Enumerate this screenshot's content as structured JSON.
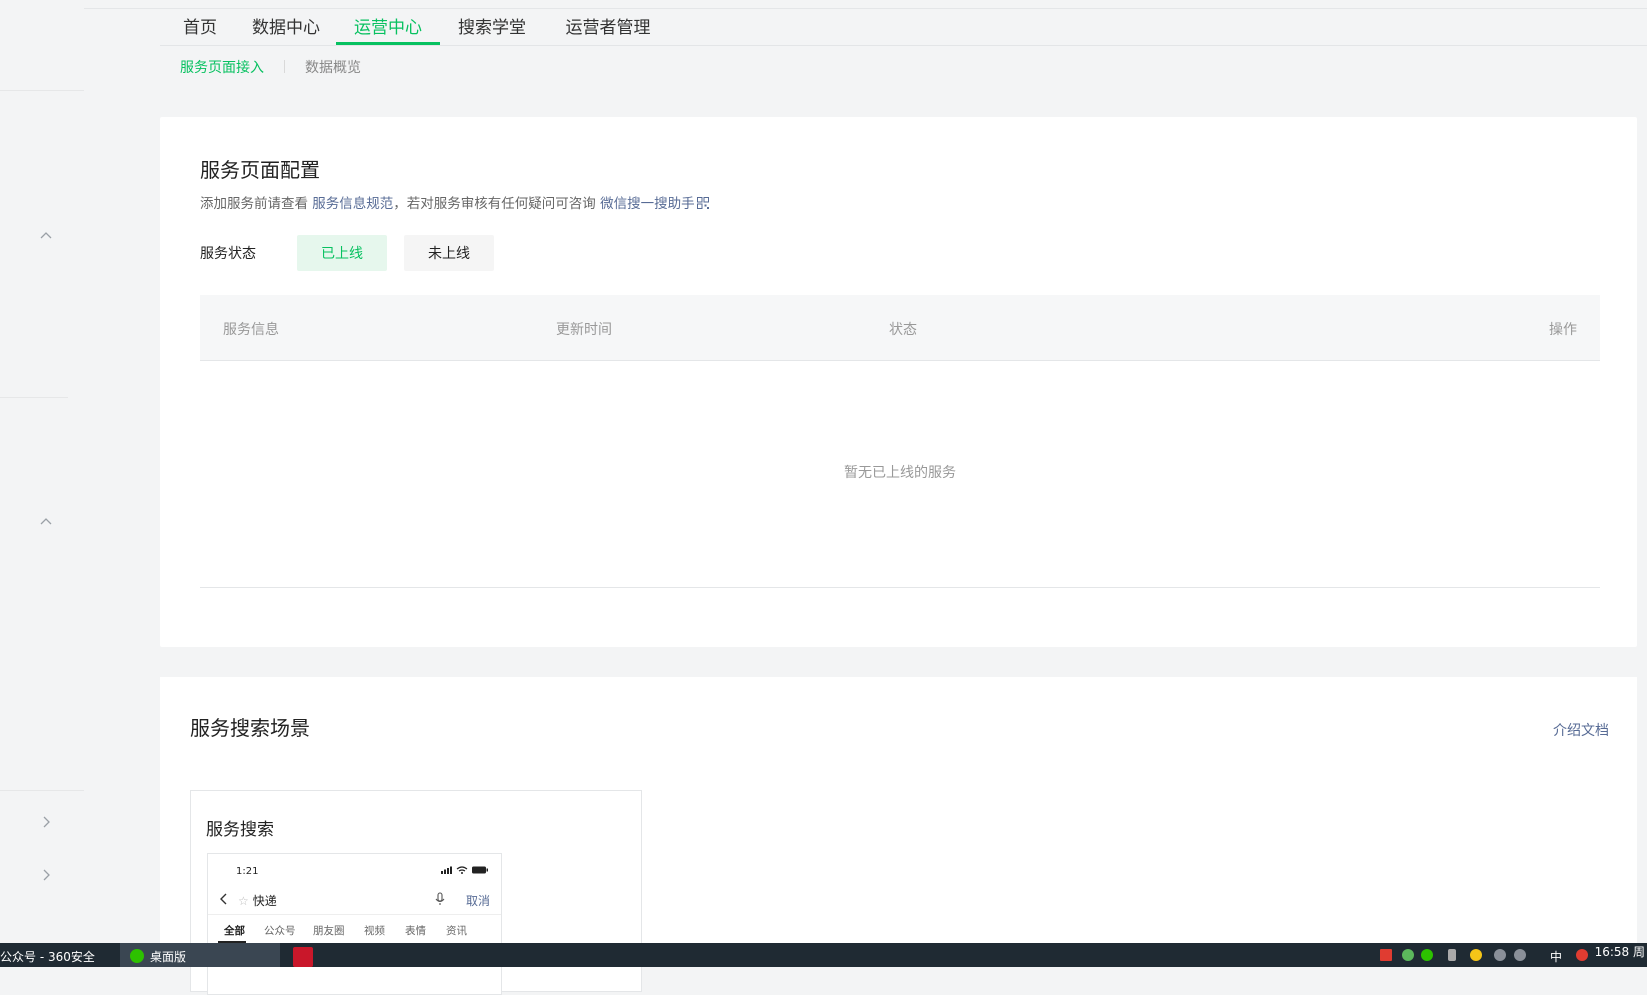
{
  "nav": {
    "items": [
      "首页",
      "数据中心",
      "运营中心",
      "搜索学堂",
      "运营者管理"
    ],
    "active_index": 2
  },
  "subnav": {
    "items": [
      "服务页面接入",
      "数据概览"
    ],
    "active_index": 0
  },
  "config_card": {
    "title": "服务页面配置",
    "desc_prefix": "添加服务前请查看",
    "desc_link1": "服务信息规范",
    "desc_middle": "，若对服务审核有任何疑问可咨询",
    "desc_link2": "微信搜一搜助手",
    "status_label": "服务状态",
    "status_online": "已上线",
    "status_offline": "未上线",
    "table_headers": [
      "服务信息",
      "更新时间",
      "状态",
      "操作"
    ],
    "empty_text": "暂无已上线的服务"
  },
  "scene_card": {
    "title": "服务搜索场景",
    "doc_link": "介绍文档",
    "scene_title": "服务搜索",
    "phone": {
      "time": "1:21",
      "query": "快递",
      "cancel": "取消",
      "tabs": [
        "全部",
        "公众号",
        "朋友圈",
        "视频",
        "表情",
        "资讯"
      ],
      "active_tab": 0
    }
  },
  "taskbar": {
    "left_text": "公众号 - 360安全",
    "task_label": "桌面版",
    "ime": "中",
    "clock": "16:58 周"
  },
  "colors": {
    "accent": "#07c160",
    "link": "#576b95",
    "page_bg": "#f3f4f5"
  }
}
